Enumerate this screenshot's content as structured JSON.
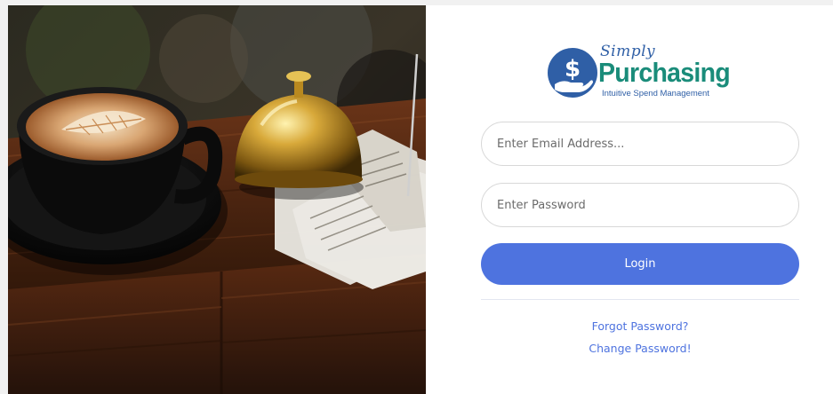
{
  "logo": {
    "simply": "Simply",
    "purchasing": "Purchasing",
    "tagline": "Intuitive Spend Management",
    "mark_symbol": "$",
    "icon": "dollar-hand-icon"
  },
  "form": {
    "email_placeholder": "Enter Email Address...",
    "password_placeholder": "Enter Password",
    "login_label": "Login",
    "forgot_password_label": "Forgot Password?",
    "change_password_label": "Change Password!"
  },
  "colors": {
    "primary": "#4e73df",
    "logo_teal": "#1a8c7a",
    "logo_blue": "#2f5fa6",
    "page_bg": "#f1f1f1"
  },
  "image": {
    "subject": "coffee-bell-receipts-photo"
  }
}
